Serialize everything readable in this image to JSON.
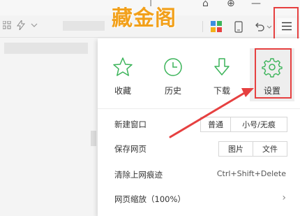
{
  "watermark": {
    "text": "藏金阁"
  },
  "colors": {
    "accent_green": "#3cb45a",
    "annotation_red": "#e64040",
    "logo_orange": "#f2a01a"
  },
  "icon_row": [
    {
      "label": "收藏",
      "icon": "star-icon"
    },
    {
      "label": "历史",
      "icon": "clock-icon"
    },
    {
      "label": "下载",
      "icon": "download-arrow-icon"
    },
    {
      "label": "设置",
      "icon": "gear-icon",
      "highlighted": true
    }
  ],
  "menu": {
    "new_window": {
      "label": "新建窗口",
      "btn_normal": "普通",
      "btn_small": "小号/无痕"
    },
    "save_page": {
      "label": "保存网页",
      "btn_image": "图片",
      "btn_file": "文件"
    },
    "clear_traces": {
      "label": "清除上网痕迹",
      "shortcut": "Ctrl+Shift+Delete"
    },
    "zoom": {
      "label": "网页缩放（100%）"
    }
  }
}
